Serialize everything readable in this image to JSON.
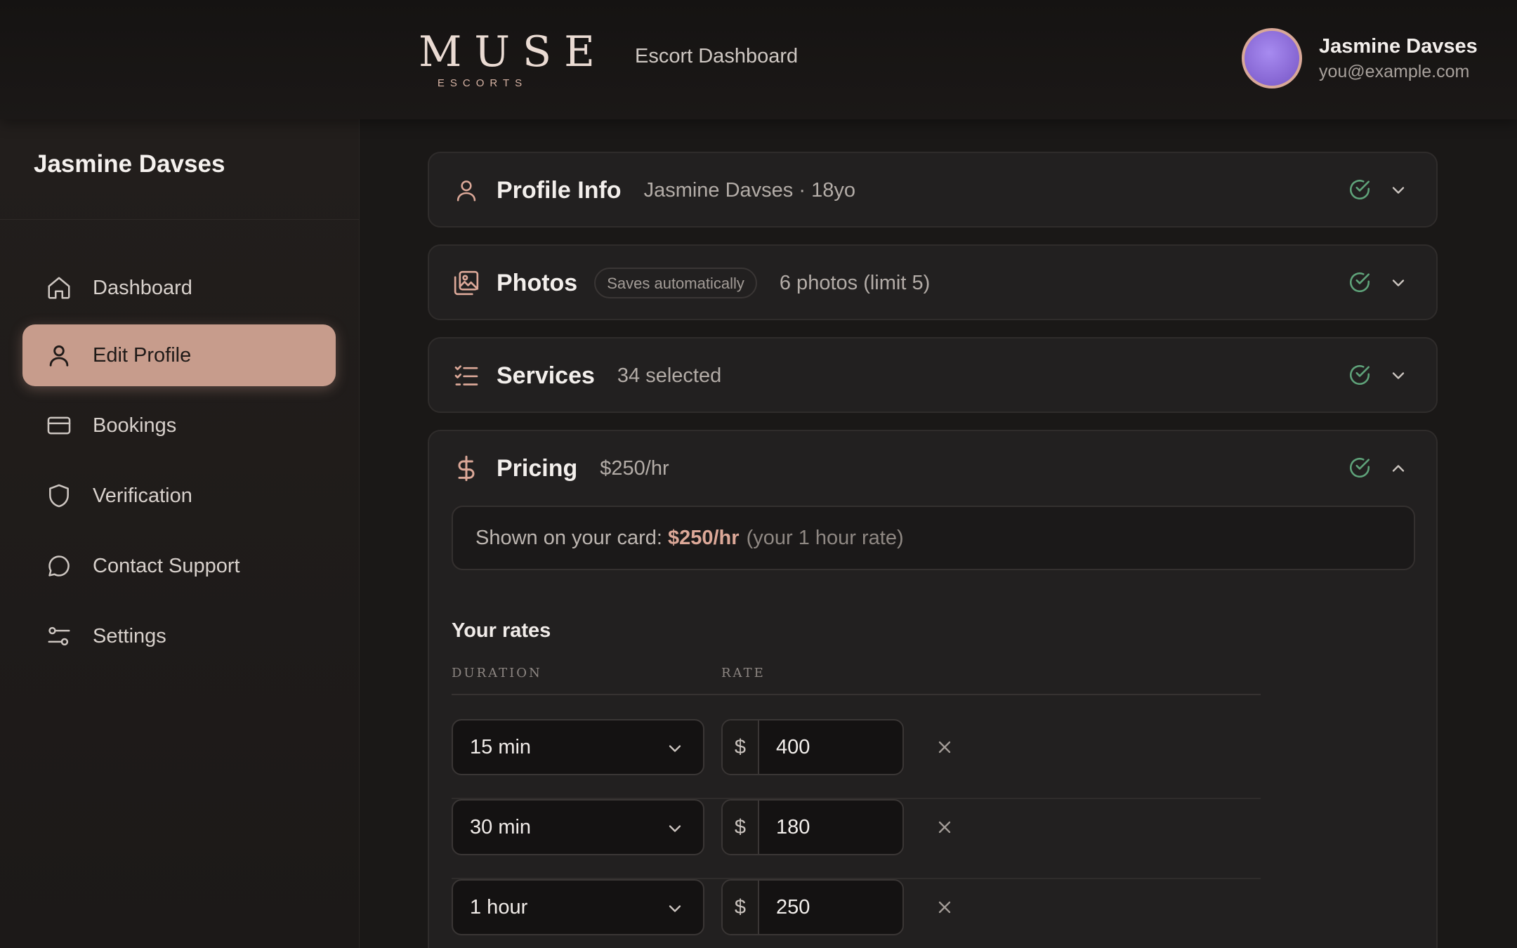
{
  "header": {
    "logo_word": "MUSE",
    "logo_sub": "ESCORTS",
    "title": "Escort Dashboard",
    "user": {
      "name": "Jasmine Davses",
      "email": "you@example.com"
    }
  },
  "sidebar": {
    "profile_name": "Jasmine Davses",
    "items": [
      {
        "label": "Dashboard",
        "icon": "home-icon"
      },
      {
        "label": "Edit Profile",
        "icon": "user-icon",
        "active": true
      },
      {
        "label": "Bookings",
        "icon": "credit-card-icon"
      },
      {
        "label": "Verification",
        "icon": "shield-icon"
      },
      {
        "label": "Contact Support",
        "icon": "chat-bubble-icon"
      },
      {
        "label": "Settings",
        "icon": "sliders-icon"
      }
    ]
  },
  "sections": {
    "profile": {
      "title": "Profile Info",
      "summary": "Jasmine Davses · 18yo",
      "icon": "user-icon",
      "complete": true
    },
    "photos": {
      "title": "Photos",
      "badge": "Saves automatically",
      "summary": "6 photos (limit 5)",
      "icon": "images-icon",
      "complete": true
    },
    "services": {
      "title": "Services",
      "summary": "34 selected",
      "icon": "checklist-icon",
      "complete": true
    },
    "pricing": {
      "title": "Pricing",
      "summary": "$250/hr",
      "icon": "dollar-icon",
      "complete": true,
      "expanded": true,
      "notice": {
        "label": "Shown on your card:",
        "price": "$250/hr",
        "note": "(your 1 hour rate)"
      },
      "rates_title": "Your rates",
      "col_duration": "DURATION",
      "col_rate": "RATE",
      "currency": "$",
      "rates": [
        {
          "duration": "15 min",
          "rate": "400"
        },
        {
          "duration": "30 min",
          "rate": "180"
        },
        {
          "duration": "1 hour",
          "rate": "250"
        }
      ]
    }
  },
  "colors": {
    "accent": "#c79c8c",
    "accent_text": "#dca898",
    "success": "#5fa37a",
    "background": "#1a1817",
    "card": "#222020"
  }
}
